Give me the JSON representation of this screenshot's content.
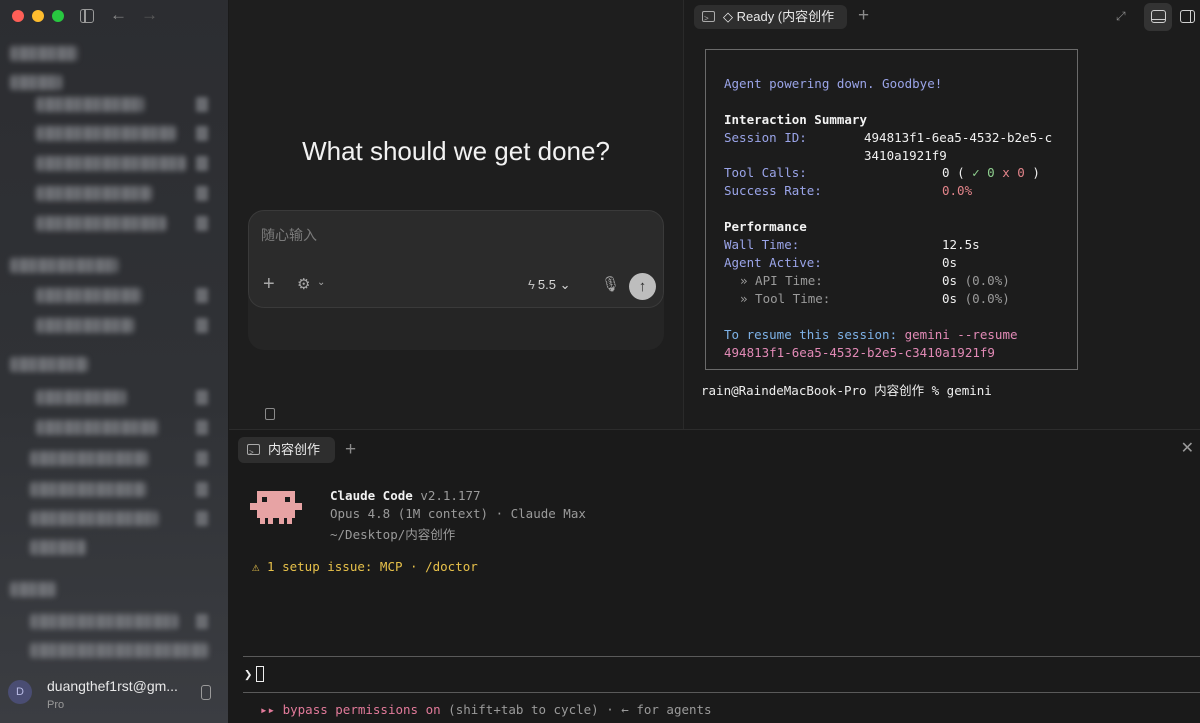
{
  "center": {
    "headline": "What should we get done?",
    "composer_placeholder": "随心输入",
    "model_label": "5.5"
  },
  "sidebar": {
    "account": {
      "avatar_initial": "D",
      "email": "duangthef1rst@gm...",
      "plan": "Pro"
    }
  },
  "top_terminal": {
    "tab_label": "◇ Ready (内容创作",
    "lines": {
      "goodbye": "Agent powering down. Goodbye!",
      "summary_heading": "Interaction Summary",
      "session_label": "Session ID:",
      "session_value_1": "494813f1-6ea5-4532-b2e5-c",
      "session_value_2": "3410a1921f9",
      "tool_calls_label": "Tool Calls:",
      "tool_calls_value": "0",
      "tool_calls_open": "(",
      "tool_calls_ok": "✓ 0",
      "tool_calls_fail": "x 0",
      "tool_calls_close": ")",
      "success_label": "Success Rate:",
      "success_value": "0.0%",
      "performance_heading": "Performance",
      "wall_label": "Wall Time:",
      "wall_value": "12.5s",
      "active_label": "Agent Active:",
      "active_value": "0s",
      "api_label": "» API Time:",
      "api_value": "0s",
      "api_pct": "(0.0%)",
      "tool_label": "» Tool Time:",
      "tool_value": "0s",
      "tool_pct": "(0.0%)",
      "resume_label": "To resume this session:",
      "resume_cmd": "gemini --resume",
      "resume_id": "494813f1-6ea5-4532-b2e5-c3410a1921f9"
    },
    "prompt": "rain@RaindeMacBook-Pro 内容创作 % gemini"
  },
  "bottom_terminal": {
    "tab_label": "内容创作",
    "app_name": "Claude Code",
    "version": "v2.1.177",
    "model_info": "Opus 4.8 (1M context) · Claude Max",
    "cwd": "~/Desktop/内容创作",
    "warning": "⚠ 1 setup issue: MCP · /doctor",
    "prompt_symbol": "❯",
    "mode_arrows": "▸▸",
    "mode_label": "bypass permissions on",
    "mode_hint": "(shift+tab to cycle) · ← for agents"
  }
}
